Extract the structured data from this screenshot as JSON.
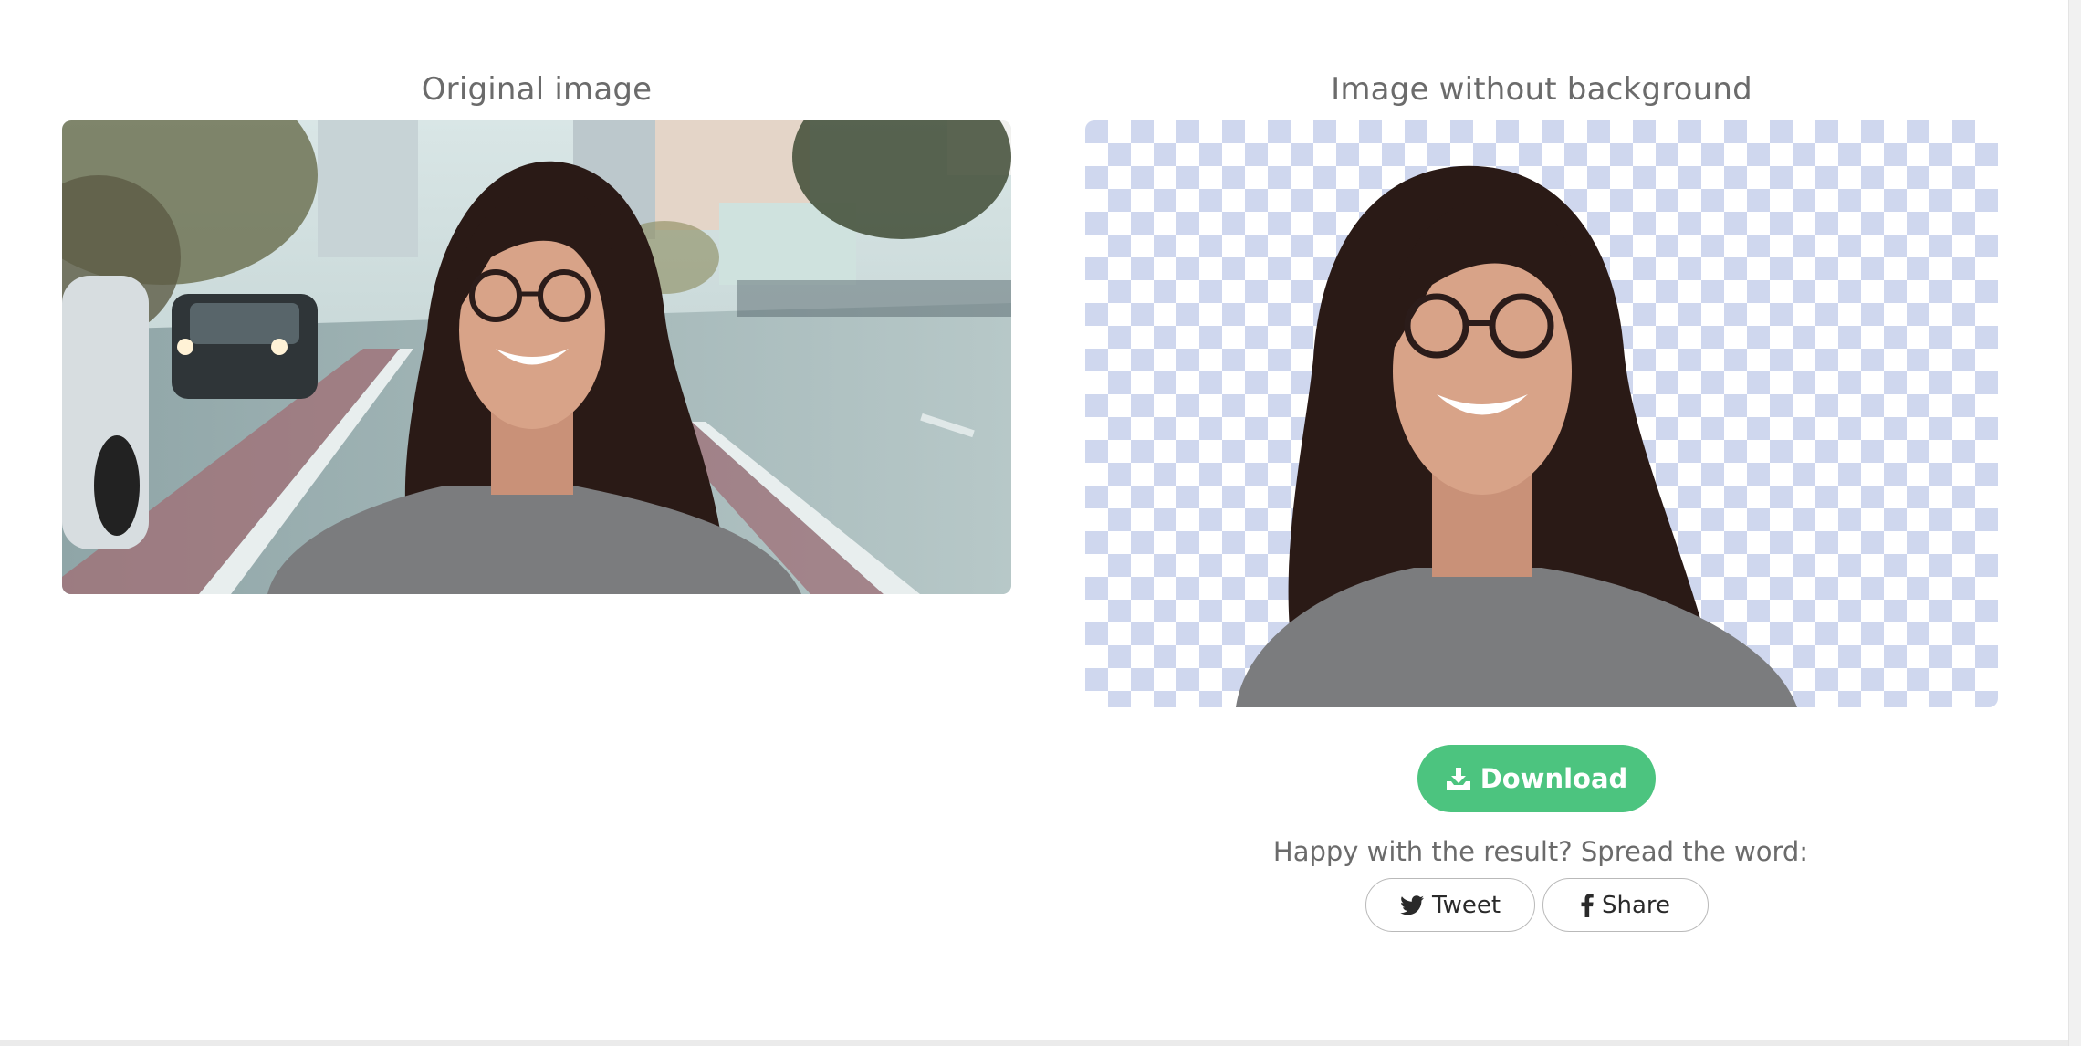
{
  "original": {
    "title": "Original image"
  },
  "result": {
    "title": "Image without background",
    "checker_color": "#cfd7ee",
    "download_label": "Download",
    "download_color": "#4cc47f"
  },
  "share": {
    "prompt": "Happy with the result? Spread the word:",
    "tweet_label": "Tweet",
    "share_label": "Share"
  }
}
